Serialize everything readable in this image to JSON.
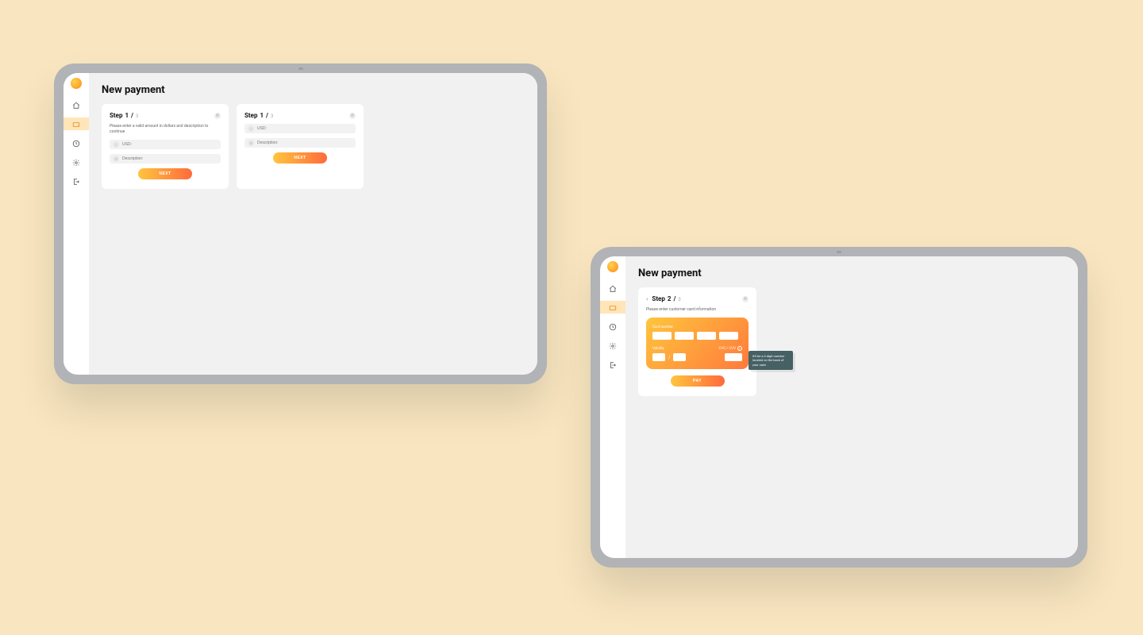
{
  "page": {
    "title": "New payment"
  },
  "sidebar": {
    "items": [
      {
        "key": "home"
      },
      {
        "key": "wallet"
      },
      {
        "key": "history"
      },
      {
        "key": "settings"
      },
      {
        "key": "logout"
      }
    ]
  },
  "step1": {
    "label": "Step",
    "current": "1",
    "total": "3",
    "instruction": "Please enter a valid amount in dollars and description to continue",
    "amount_label": "USD:",
    "description_label": "Description:",
    "clear_symbol": "⊘",
    "cta": "NEXT"
  },
  "step2": {
    "label": "Step",
    "current": "2",
    "total": "3",
    "instruction": "Please enter customer card information",
    "card_number_label": "Card number",
    "validity_label": "Validity",
    "validity_sep": "/",
    "cvc_label": "CVC / CVV",
    "clear_symbol": "⊘",
    "tooltip": "It'll be a 3 digit number located on the back of your card.",
    "cta": "PAY"
  }
}
